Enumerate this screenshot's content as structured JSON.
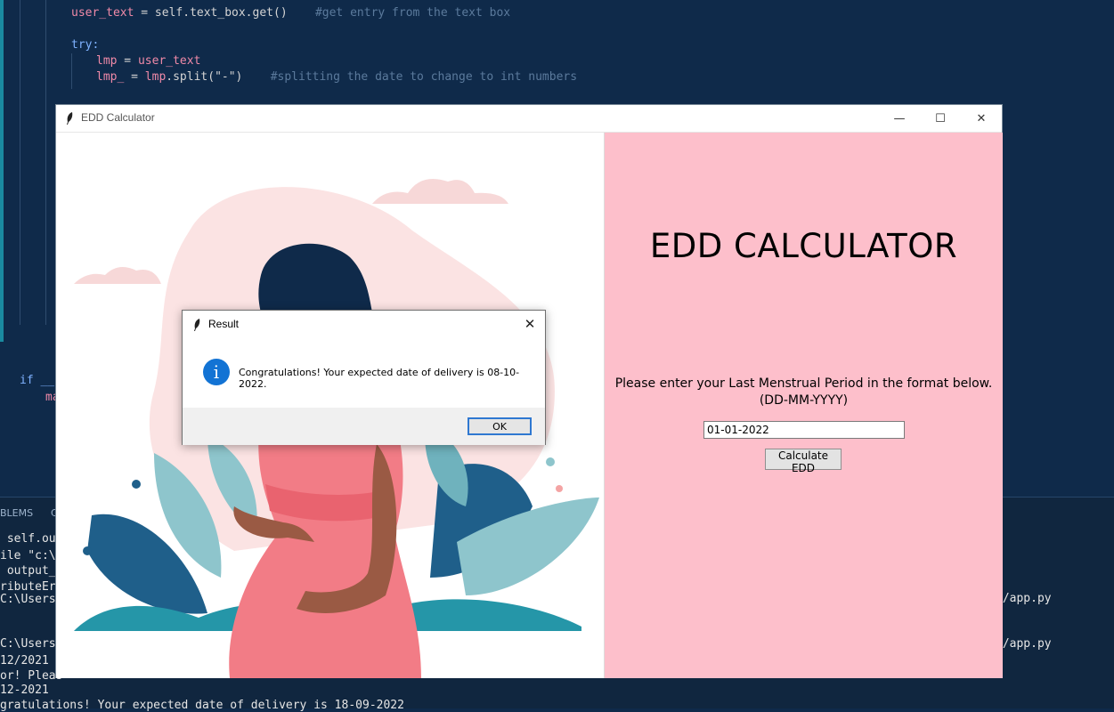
{
  "editor": {
    "code_lines": [
      {
        "pre": "user_text",
        "mid": " = self.text_box.get()    ",
        "comment": "#get entry from the text box"
      },
      {
        "kw": "try:"
      },
      {
        "pre": "lmp",
        "mid": " = ",
        "pre2": "user_text"
      },
      {
        "pre": "lmp_",
        "mid": " = ",
        "pre2": "lmp",
        "mid2": ".split(\"-\")    ",
        "comment": "#splitting the date to change to int numbers"
      }
    ],
    "if_line": "if __n",
    "ma_line": "ma"
  },
  "panel": {
    "tab_problems": "BLEMS",
    "tab_c": "C",
    "terminal_lines": [
      " self.out",
      "ile \"c:\\U",
      " output_m",
      "ributeErr",
      "C:\\Users\\",
      "",
      "",
      "C:\\Users\\",
      "12/2021",
      "or! Pleas",
      "12-2021",
      "gratulations! Your expected date of delivery is 18-09-2022"
    ],
    "right_lines": [
      "r/app.py",
      "r/app.py"
    ]
  },
  "window": {
    "title": "EDD Calculator",
    "minimize": "—",
    "maximize": "☐",
    "close": "✕"
  },
  "app": {
    "heading": "EDD CALCULATOR",
    "prompt_line1": "Please enter your Last Menstrual Period in the format below.",
    "prompt_line2": "(DD-MM-YYYY)",
    "date_value": "01-01-2022",
    "calculate_label": "Calculate  EDD",
    "pane_color": "#fdbfcb"
  },
  "dialog": {
    "title": "Result",
    "close": "✕",
    "icon": "info-icon",
    "message": "Congratulations! Your expected date of delivery is 08-10-2022.",
    "ok_label": "OK"
  }
}
